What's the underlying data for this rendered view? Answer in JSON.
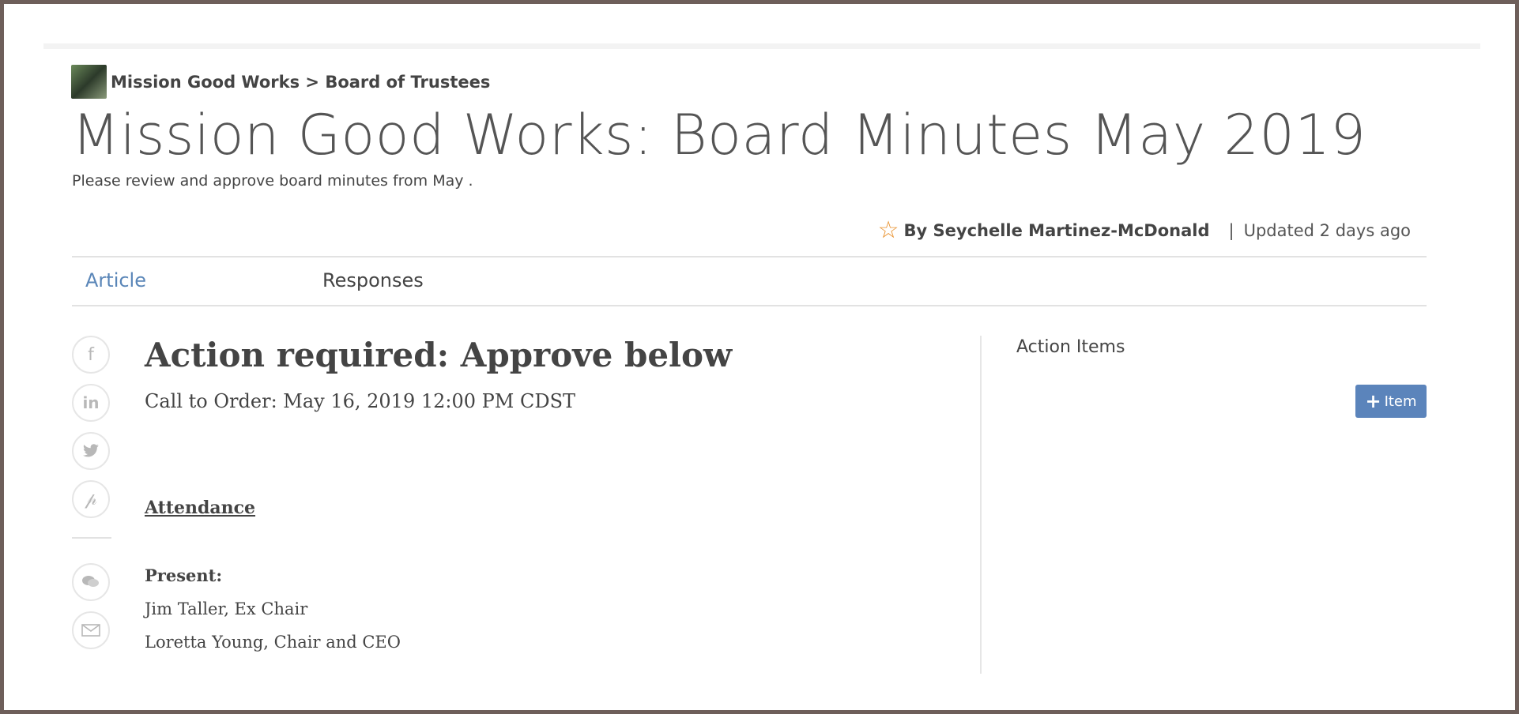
{
  "breadcrumb": {
    "group": "Mission Good Works",
    "separator": ">",
    "section": "Board of Trustees"
  },
  "article": {
    "title": "Mission Good Works: Board Minutes May 2019",
    "subtitle": "Please review and approve board minutes from May .",
    "author": "By Seychelle Martinez-McDonald",
    "separator": "|",
    "updated": "Updated 2 days ago"
  },
  "tabs": [
    "Article",
    "Responses"
  ],
  "body": {
    "heading": "Action required: Approve below",
    "call_to_order": "Call to Order: May 16, 2019 12:00 PM CDST",
    "attendance_label": "Attendance",
    "present_label": "Present:",
    "people": [
      "Jim Taller, Ex Chair",
      "Loretta Young, Chair and CEO"
    ]
  },
  "sidebar": {
    "heading": "Action Items",
    "add_button_label": "Item"
  },
  "share_icons": [
    "facebook-icon",
    "linkedin-icon",
    "twitter-icon",
    "pinterest-icon",
    "comment-icon",
    "email-icon"
  ],
  "colors": {
    "accent_blue": "#5b84bb",
    "tab_active": "#5a86b8",
    "star": "#e8912e",
    "frame": "#6e5f5a"
  }
}
